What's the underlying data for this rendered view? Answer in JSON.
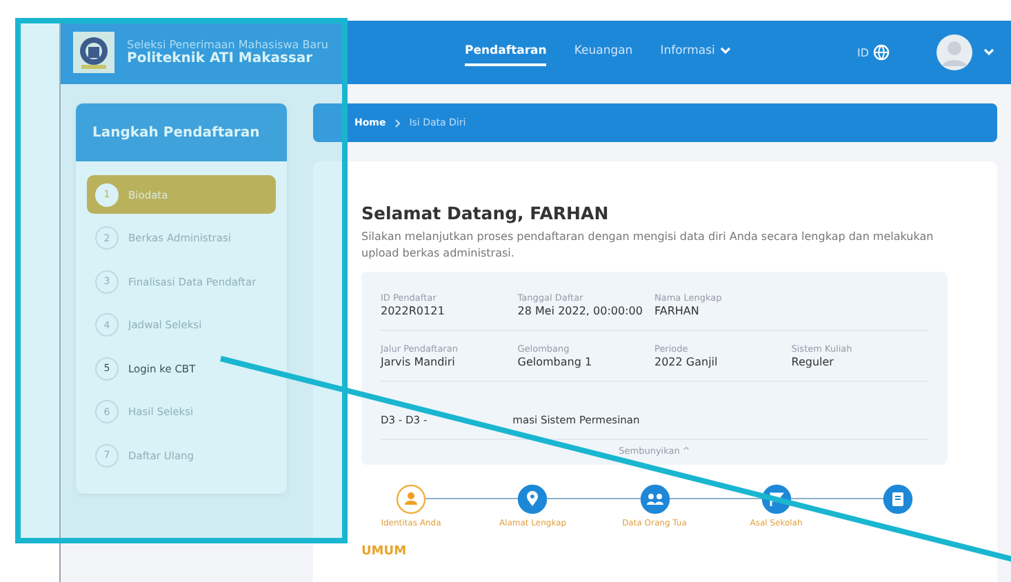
{
  "header": {
    "subtitle": "Seleksi Penerimaan Mahasiswa Baru",
    "title": "Politeknik ATI Makassar",
    "nav": [
      {
        "label": "Pendaftaran",
        "selected": true,
        "dropdown": false
      },
      {
        "label": "Keuangan",
        "selected": false,
        "dropdown": false
      },
      {
        "label": "Informasi",
        "selected": false,
        "dropdown": true
      }
    ],
    "language": "ID"
  },
  "sidebar": {
    "title": "Langkah Pendaftaran",
    "steps": [
      {
        "number": "1",
        "label": "Biodata",
        "selected": true,
        "disabled": false
      },
      {
        "number": "2",
        "label": "Berkas Administrasi",
        "selected": false,
        "disabled": true
      },
      {
        "number": "3",
        "label": "Finalisasi Data Pendaftar",
        "selected": false,
        "disabled": true
      },
      {
        "number": "4",
        "label": "Jadwal Seleksi",
        "selected": false,
        "disabled": true
      },
      {
        "number": "5",
        "label": "Login ke CBT",
        "selected": false,
        "disabled": false
      },
      {
        "number": "6",
        "label": "Hasil Seleksi",
        "selected": false,
        "disabled": true
      },
      {
        "number": "7",
        "label": "Daftar Ulang",
        "selected": false,
        "disabled": true
      }
    ]
  },
  "breadcrumb": [
    "Home",
    "Isi Data Diri"
  ],
  "welcome": {
    "title": "Selamat Datang, FARHAN",
    "text": "Silakan melanjutkan proses pendaftaran dengan mengisi data diri Anda secara lengkap dan melakukan upload berkas administrasi."
  },
  "info_rows": [
    [
      {
        "label": "ID Pendaftar",
        "value": "2022R0121"
      },
      {
        "label": "Tanggal Daftar",
        "value": "28 Mei 2022, 00:00:00"
      },
      {
        "label": "Nama Lengkap",
        "value": "FARHAN"
      }
    ],
    [
      {
        "label": "Jalur Pendaftaran",
        "value": "Jarvis Mandiri"
      },
      {
        "label": "Gelombang",
        "value": "Gelombang 1"
      },
      {
        "label": "Periode",
        "value": "2022 Ganjil"
      },
      {
        "label": "Sistem Kuliah",
        "value": "Reguler"
      }
    ],
    [
      {
        "value_parts": [
          "D3 - D3 -",
          "masi Sistem Permesinan"
        ]
      }
    ]
  ],
  "toggle": "Sembunyikan ^",
  "form_steps": [
    {
      "kind": "person",
      "label": "Identitas Anda",
      "selected": true
    },
    {
      "kind": "pin",
      "label": "Alamat Lengkap",
      "selected": false
    },
    {
      "kind": "people",
      "label": "Data Orang Tua",
      "selected": false
    },
    {
      "kind": "flag",
      "label": "Asal Sekolah",
      "selected": false
    },
    {
      "kind": "book",
      "selected": false
    }
  ],
  "section_title": "UMUM"
}
